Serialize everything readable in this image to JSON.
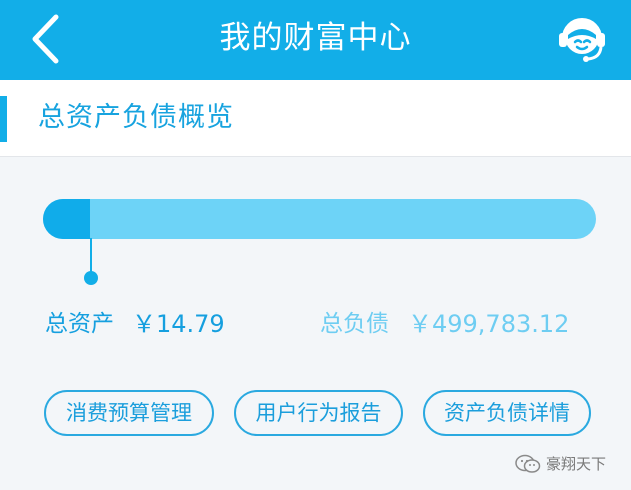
{
  "header": {
    "title": "我的财富中心",
    "back_icon": "chevron-left-icon",
    "service_icon": "customer-service-icon",
    "background": "#12aee8"
  },
  "section": {
    "title": "总资产负债概览"
  },
  "overview": {
    "asset_label": "总资产",
    "asset_value": "￥14.79",
    "debt_label": "总负债",
    "debt_value": "￥499,783.12",
    "asset_share_shown": 0.085,
    "asset_color": "#10acea",
    "debt_color": "#6dd3f7"
  },
  "actions": [
    {
      "label": "消费预算管理"
    },
    {
      "label": "用户行为报告"
    },
    {
      "label": "资产负债详情"
    }
  ],
  "watermark": {
    "text": "豪翔天下",
    "icon": "wechat-icon"
  }
}
